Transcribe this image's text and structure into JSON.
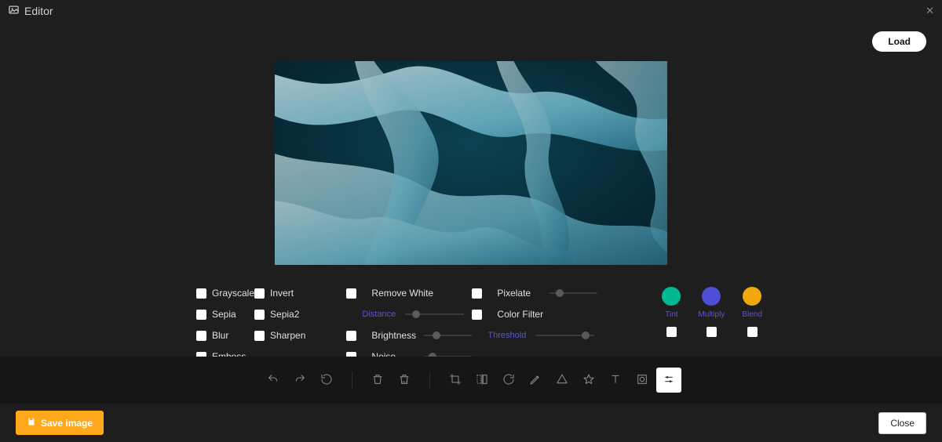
{
  "header": {
    "title": "Editor"
  },
  "buttons": {
    "load": "Load",
    "save": "Save image",
    "close": "Close"
  },
  "filters": {
    "left": [
      {
        "key": "grayscale",
        "label": "Grayscale"
      },
      {
        "key": "sepia",
        "label": "Sepia"
      },
      {
        "key": "blur",
        "label": "Blur"
      },
      {
        "key": "emboss",
        "label": "Emboss"
      }
    ],
    "left2": [
      {
        "key": "invert",
        "label": "Invert"
      },
      {
        "key": "sepia2",
        "label": "Sepia2"
      },
      {
        "key": "sharpen",
        "label": "Sharpen"
      }
    ],
    "mid": [
      {
        "key": "remove-white",
        "label": "Remove White",
        "type": "check"
      },
      {
        "key": "distance",
        "label": "Distance",
        "type": "slider",
        "pos": 18
      },
      {
        "key": "brightness",
        "label": "Brightness",
        "type": "check-slider",
        "pos": 25
      },
      {
        "key": "noise",
        "label": "Noise",
        "type": "check-slider",
        "pos": 18
      }
    ],
    "mid2": [
      {
        "key": "pixelate",
        "label": "Pixelate",
        "type": "check-slider",
        "pos": 20
      },
      {
        "key": "colorfilter",
        "label": "Color Filter",
        "type": "check"
      },
      {
        "key": "threshold",
        "label": "Threshold",
        "type": "slider",
        "pos": 85
      }
    ]
  },
  "colors": [
    {
      "key": "tint",
      "label": "Tint",
      "hex": "#00b894"
    },
    {
      "key": "multiply",
      "label": "Multiply",
      "hex": "#4e4ed6"
    },
    {
      "key": "blend",
      "label": "Blend",
      "hex": "#f1a80c"
    }
  ],
  "toolbar": [
    {
      "key": "undo",
      "icon": "undo"
    },
    {
      "key": "redo",
      "icon": "redo"
    },
    {
      "key": "reset",
      "icon": "reset"
    },
    {
      "key": "sep"
    },
    {
      "key": "delete",
      "icon": "trash"
    },
    {
      "key": "delete-all",
      "icon": "trash-all"
    },
    {
      "key": "sep"
    },
    {
      "key": "crop",
      "icon": "crop"
    },
    {
      "key": "flip",
      "icon": "flip"
    },
    {
      "key": "rotate",
      "icon": "rotate"
    },
    {
      "key": "draw",
      "icon": "pencil"
    },
    {
      "key": "shape",
      "icon": "shape"
    },
    {
      "key": "icon",
      "icon": "star"
    },
    {
      "key": "text",
      "icon": "text"
    },
    {
      "key": "mask",
      "icon": "mask"
    },
    {
      "key": "filter",
      "icon": "sliders",
      "active": true
    }
  ]
}
